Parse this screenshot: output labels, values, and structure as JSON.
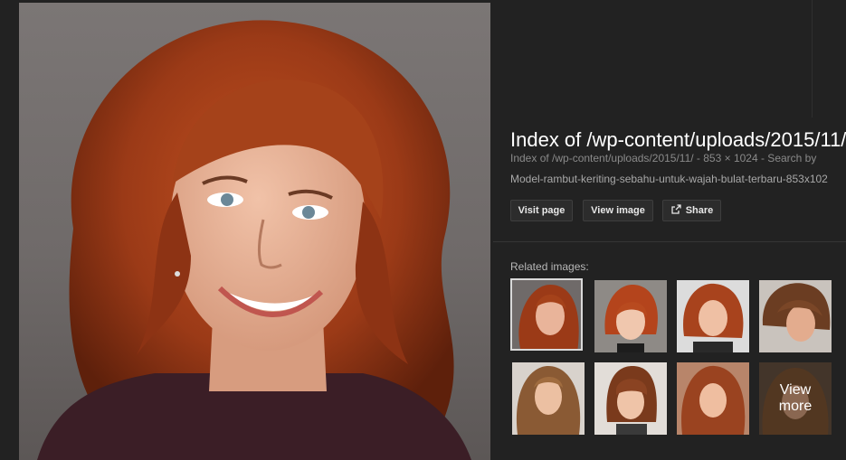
{
  "image_preview": {
    "alt": "Woman with curly auburn hair smiling"
  },
  "details": {
    "title": "Index of /wp-content/uploads/2015/11/",
    "meta": "Index of /wp-content/uploads/2015/11/ - 853 × 1024 - Search by",
    "filename": "Model-rambut-keriting-sebahu-untuk-wajah-bulat-terbaru-853x102"
  },
  "actions": {
    "visit": "Visit page",
    "view": "View image",
    "share": "Share"
  },
  "related": {
    "label": "Related images:",
    "more_line1": "View",
    "more_line2": "more"
  },
  "colors": {
    "background": "#222222",
    "hair": "#9b3a17",
    "skin": "#e9b49a"
  }
}
